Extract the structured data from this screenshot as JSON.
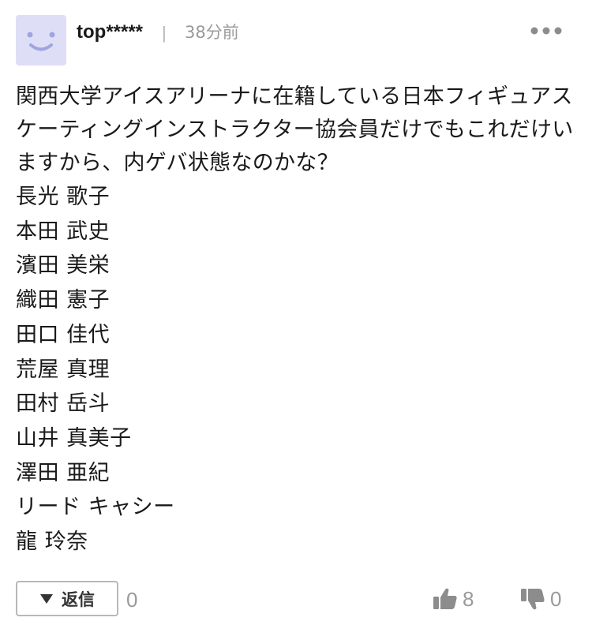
{
  "comment": {
    "user": {
      "name": "top*****",
      "avatar_icon": "smiley-face-icon",
      "avatar_color": "#dedff6"
    },
    "separator": "|",
    "time_ago": "38分前",
    "more_icon": "more-dots-icon",
    "body": "関西大学アイスアリーナに在籍している日本フィギュアスケーティングインストラクター協会員だけでもこれだけいますから、内ゲバ状態なのかな？",
    "names": [
      "長光 歌子",
      "本田 武史",
      "濱田 美栄",
      "織田 憲子",
      "田口 佳代",
      "荒屋 真理",
      "田村 岳斗",
      "山井 真美子",
      "澤田 亜紀",
      "リード キャシー",
      "龍 玲奈"
    ],
    "reply": {
      "label": "返信",
      "icon": "triangle-down-icon",
      "count": "0"
    },
    "likes": {
      "icon": "thumbs-up-icon",
      "count": "8"
    },
    "dislikes": {
      "icon": "thumbs-down-icon",
      "count": "0"
    },
    "colors": {
      "icon_gray": "#8c8c8c",
      "meta_text": "#9a9a9a"
    }
  }
}
